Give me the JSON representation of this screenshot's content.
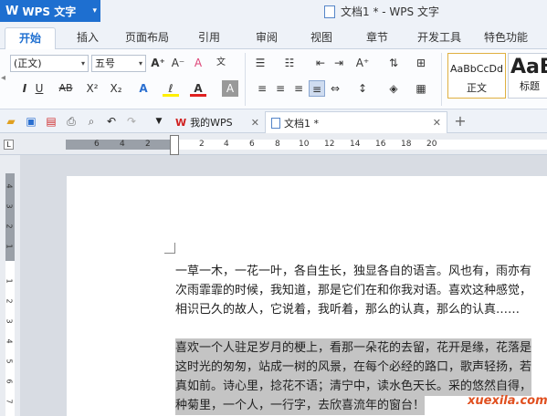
{
  "app": {
    "logo": "W",
    "name": "WPS 文字",
    "title": "文档1 * - WPS 文字"
  },
  "tabs": [
    "开始",
    "插入",
    "页面布局",
    "引用",
    "审阅",
    "视图",
    "章节",
    "开发工具",
    "特色功能"
  ],
  "ribbon": {
    "font_name": "(正文)",
    "font_size": "五号",
    "styles": [
      {
        "preview": "AaBbCcDd",
        "label": "正文"
      },
      {
        "preview": "AaB",
        "label": "标题"
      }
    ]
  },
  "doc_tabs": [
    {
      "label": "我的WPS"
    },
    {
      "label": "文档1 *"
    }
  ],
  "ruler": {
    "h_numbers": [
      "6",
      "4",
      "2",
      "2",
      "4",
      "6",
      "8",
      "10",
      "12",
      "14",
      "16",
      "18",
      "20"
    ],
    "v_numbers": [
      "4",
      "3",
      "2",
      "1",
      "1",
      "2",
      "3",
      "4",
      "5",
      "6",
      "7"
    ]
  },
  "document": {
    "para1": [
      "一草一木，一花一叶，各自生长，独显各自的语言。风也有，雨亦有",
      "次雨霏霏的时候，我知道，那是它们在和你我对语。喜欢这种感觉，",
      "相识已久的故人，它说着，我听着，那么的认真，那么的认真……"
    ],
    "para2": [
      "喜欢一个人驻足岁月的梗上，看那一朵花的去留，花开是缘，花落是",
      "这时光的匆匆，站成一树的风景，在每个必经的路口，歌声轻扬，若",
      "真如前。诗心里，捻花不语；清宁中，读水色天长。采的悠然自得，",
      "种菊里，一个人，一行字，去欣喜流年的窗台！"
    ]
  },
  "watermark": "xuexila.com"
}
